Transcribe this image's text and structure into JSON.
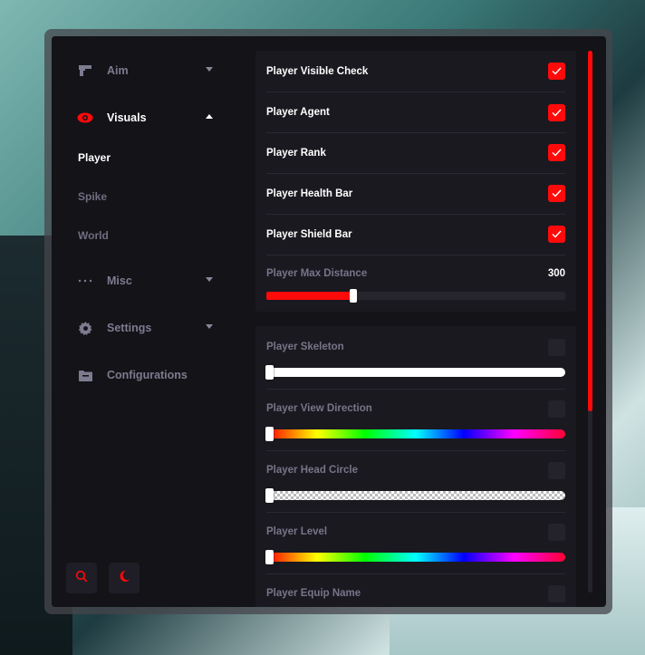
{
  "accent_color": "#ff0a0a",
  "sidebar": {
    "items": [
      {
        "label": "Aim",
        "icon": "gun-icon"
      },
      {
        "label": "Visuals",
        "icon": "eye-icon"
      },
      {
        "label": "Misc",
        "icon": "dots-icon"
      },
      {
        "label": "Settings",
        "icon": "gear-icon"
      },
      {
        "label": "Configurations",
        "icon": "folder-icon"
      }
    ],
    "visuals_sub": [
      "Player",
      "Spike",
      "World"
    ],
    "bottom_buttons": [
      "search-icon",
      "moon-icon"
    ]
  },
  "player_options": {
    "checks": [
      {
        "label": "Player Visible Check",
        "checked": true
      },
      {
        "label": "Player Agent",
        "checked": true
      },
      {
        "label": "Player Rank",
        "checked": true
      },
      {
        "label": "Player Health Bar",
        "checked": true
      },
      {
        "label": "Player Shield Bar",
        "checked": true
      }
    ],
    "max_distance": {
      "label": "Player Max Distance",
      "value": "300",
      "fill_fraction": 0.29
    }
  },
  "color_options": [
    {
      "label": "Player Skeleton",
      "checked": false,
      "style": "white"
    },
    {
      "label": "Player View Direction",
      "checked": false,
      "style": "rainbow"
    },
    {
      "label": "Player Head Circle",
      "checked": false,
      "style": "checker"
    },
    {
      "label": "Player Level",
      "checked": false,
      "style": "rainbow"
    },
    {
      "label": "Player Equip Name",
      "checked": false,
      "style": "none"
    }
  ]
}
